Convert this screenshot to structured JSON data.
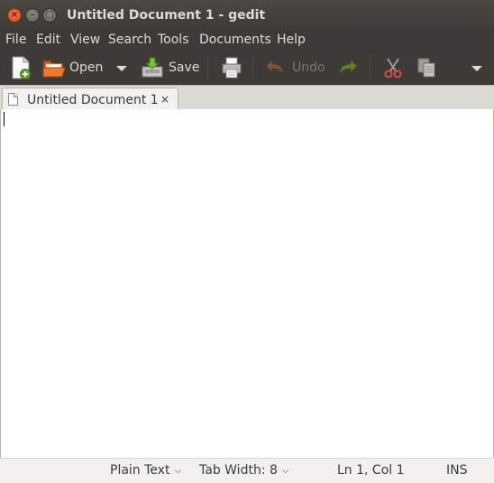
{
  "window": {
    "title": "Untitled Document 1 - gedit",
    "close_glyph": "×",
    "minimize_glyph": "–",
    "maximize_glyph": "□"
  },
  "menu": {
    "items": [
      {
        "label": "File"
      },
      {
        "label": "Edit"
      },
      {
        "label": "View"
      },
      {
        "label": "Search"
      },
      {
        "label": "Tools"
      },
      {
        "label": "Documents"
      },
      {
        "label": "Help"
      }
    ]
  },
  "toolbar": {
    "new_icon": "new-document-icon",
    "open_label": "Open",
    "open_icon": "folder-open-icon",
    "save_label": "Save",
    "save_icon": "save-icon",
    "print_icon": "printer-icon",
    "undo_label": "Undo",
    "undo_icon": "undo-icon",
    "redo_icon": "redo-icon",
    "cut_icon": "scissors-icon",
    "copy_icon": "copy-icon",
    "overflow_icon": "chevron-down-icon"
  },
  "tabs": [
    {
      "label": "Untitled Document 1",
      "close_glyph": "×",
      "icon": "text-file-icon"
    }
  ],
  "editor": {
    "content": ""
  },
  "statusbar": {
    "language": "Plain Text",
    "tab_width": "Tab Width: 8",
    "position": "Ln 1, Col 1",
    "mode": "INS"
  },
  "colors": {
    "titlebar": "#3c3b37",
    "close_button": "#e95420",
    "editor_bg": "#ffffff",
    "statusbar_bg": "#f2f1ef"
  }
}
